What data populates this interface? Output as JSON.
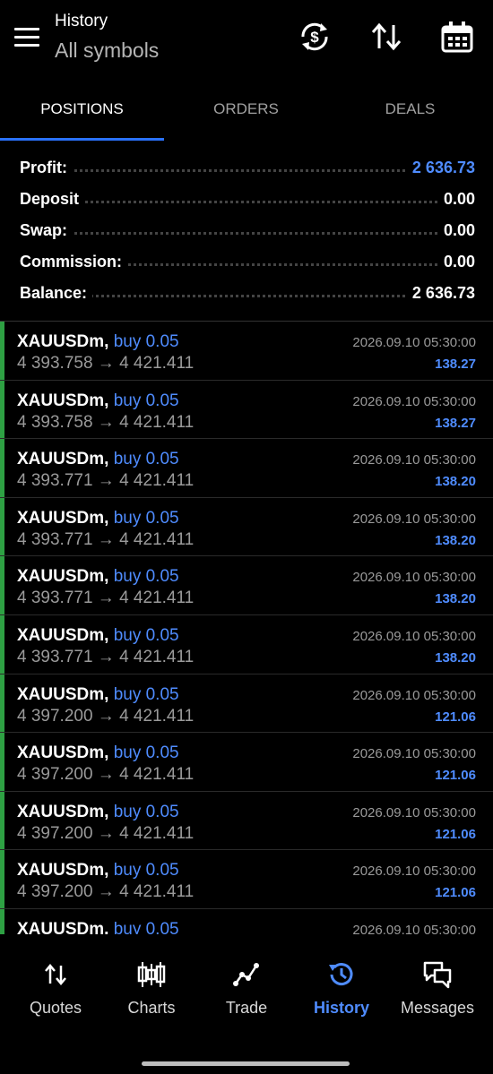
{
  "header": {
    "title": "History",
    "subtitle": "All symbols",
    "icons": [
      "menu-icon",
      "currency-exchange-icon",
      "sort-icon",
      "calendar-icon"
    ]
  },
  "tabs": [
    {
      "label": "POSITIONS",
      "active": true
    },
    {
      "label": "ORDERS",
      "active": false
    },
    {
      "label": "DEALS",
      "active": false
    }
  ],
  "summary": {
    "profit": {
      "label": "Profit:",
      "value": "2 636.73"
    },
    "deposit": {
      "label": "Deposit",
      "value": "0.00"
    },
    "swap": {
      "label": "Swap:",
      "value": "0.00"
    },
    "commission": {
      "label": "Commission:",
      "value": "0.00"
    },
    "balance": {
      "label": "Balance:",
      "value": "2 636.73"
    }
  },
  "positions": [
    {
      "symbol": "XAUUSDm,",
      "side": "buy 0.05",
      "prices": "4 393.758 → 4 421.411",
      "time": "2026.09.10 05:30:00",
      "profit": "138.27"
    },
    {
      "symbol": "XAUUSDm,",
      "side": "buy 0.05",
      "prices": "4 393.758 → 4 421.411",
      "time": "2026.09.10 05:30:00",
      "profit": "138.27"
    },
    {
      "symbol": "XAUUSDm,",
      "side": "buy 0.05",
      "prices": "4 393.771 → 4 421.411",
      "time": "2026.09.10 05:30:00",
      "profit": "138.20"
    },
    {
      "symbol": "XAUUSDm,",
      "side": "buy 0.05",
      "prices": "4 393.771 → 4 421.411",
      "time": "2026.09.10 05:30:00",
      "profit": "138.20"
    },
    {
      "symbol": "XAUUSDm,",
      "side": "buy 0.05",
      "prices": "4 393.771 → 4 421.411",
      "time": "2026.09.10 05:30:00",
      "profit": "138.20"
    },
    {
      "symbol": "XAUUSDm,",
      "side": "buy 0.05",
      "prices": "4 393.771 → 4 421.411",
      "time": "2026.09.10 05:30:00",
      "profit": "138.20"
    },
    {
      "symbol": "XAUUSDm,",
      "side": "buy 0.05",
      "prices": "4 397.200 → 4 421.411",
      "time": "2026.09.10 05:30:00",
      "profit": "121.06"
    },
    {
      "symbol": "XAUUSDm,",
      "side": "buy 0.05",
      "prices": "4 397.200 → 4 421.411",
      "time": "2026.09.10 05:30:00",
      "profit": "121.06"
    },
    {
      "symbol": "XAUUSDm,",
      "side": "buy 0.05",
      "prices": "4 397.200 → 4 421.411",
      "time": "2026.09.10 05:30:00",
      "profit": "121.06"
    },
    {
      "symbol": "XAUUSDm,",
      "side": "buy 0.05",
      "prices": "4 397.200 → 4 421.411",
      "time": "2026.09.10 05:30:00",
      "profit": "121.06"
    },
    {
      "symbol": "XAUUSDm,",
      "side": "buy 0.05",
      "prices": "",
      "time": "2026.09.10 05:30:00",
      "profit": ""
    }
  ],
  "nav": [
    {
      "label": "Quotes",
      "icon": "quotes-icon",
      "active": false
    },
    {
      "label": "Charts",
      "icon": "charts-icon",
      "active": false
    },
    {
      "label": "Trade",
      "icon": "trade-icon",
      "active": false
    },
    {
      "label": "History",
      "icon": "history-icon",
      "active": true
    },
    {
      "label": "Messages",
      "icon": "messages-icon",
      "active": false
    }
  ],
  "colors": {
    "accent": "#4f8cff",
    "tab_underline": "#2a72ff",
    "position_bar": "#2ea043",
    "background": "#000000"
  }
}
